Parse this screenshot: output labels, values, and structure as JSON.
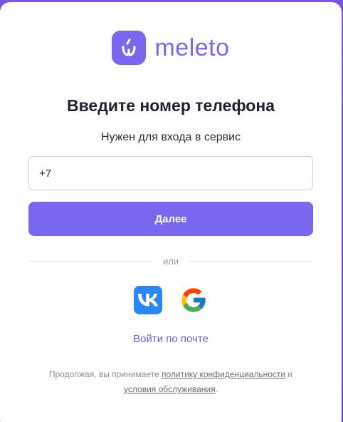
{
  "brand": {
    "name": "meleto",
    "color": "#7a67f0",
    "logo_icon": "meleto-logo-icon"
  },
  "heading": {
    "title": "Введите номер телефона",
    "subtitle": "Нужен для входа в сервис"
  },
  "phone_field": {
    "value": "+7"
  },
  "next_button": {
    "label": "Далее"
  },
  "divider": {
    "label": "или"
  },
  "social": [
    {
      "name": "VK",
      "icon": "vk-icon",
      "color": "#2787f5"
    },
    {
      "name": "Google",
      "icon": "google-icon"
    }
  ],
  "email_login": {
    "label": "Войти по почте"
  },
  "legal": {
    "prefix": "Продолжая, вы принимаете ",
    "privacy_link": "политику конфиденциальности",
    "conjunction": " и ",
    "terms_link": "условия обслуживания",
    "suffix": "."
  }
}
